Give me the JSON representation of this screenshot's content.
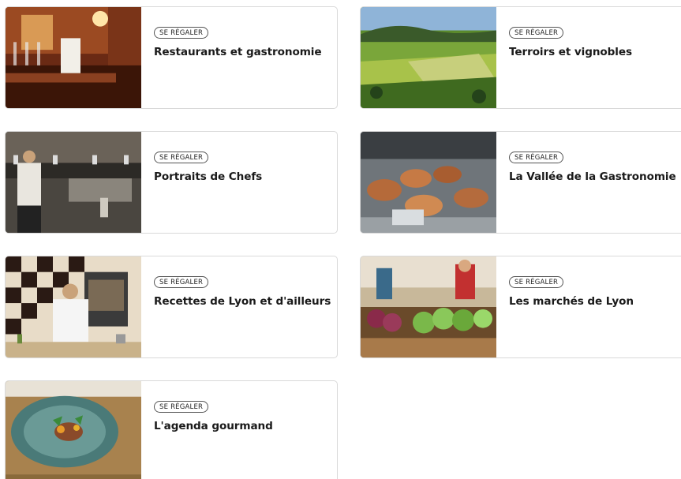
{
  "cards": [
    {
      "badge": "SE RÉGALER",
      "title": "Restaurants et gastronomie",
      "image": "restaurant-interior"
    },
    {
      "badge": "SE RÉGALER",
      "title": "Terroirs et vignobles",
      "image": "vineyard-landscape"
    },
    {
      "badge": "SE RÉGALER",
      "title": "Portraits de Chefs",
      "image": "kitchen-chef"
    },
    {
      "badge": "SE RÉGALER",
      "title": "La Vallée de la Gastronomie",
      "image": "copper-pans"
    },
    {
      "badge": "SE RÉGALER",
      "title": "Recettes de Lyon et d'ailleurs",
      "image": "chef-cooking"
    },
    {
      "badge": "SE RÉGALER",
      "title": "Les marchés de Lyon",
      "image": "market-stall"
    },
    {
      "badge": "SE RÉGALER",
      "title": "L'agenda gourmand",
      "image": "gourmet-dish"
    }
  ]
}
